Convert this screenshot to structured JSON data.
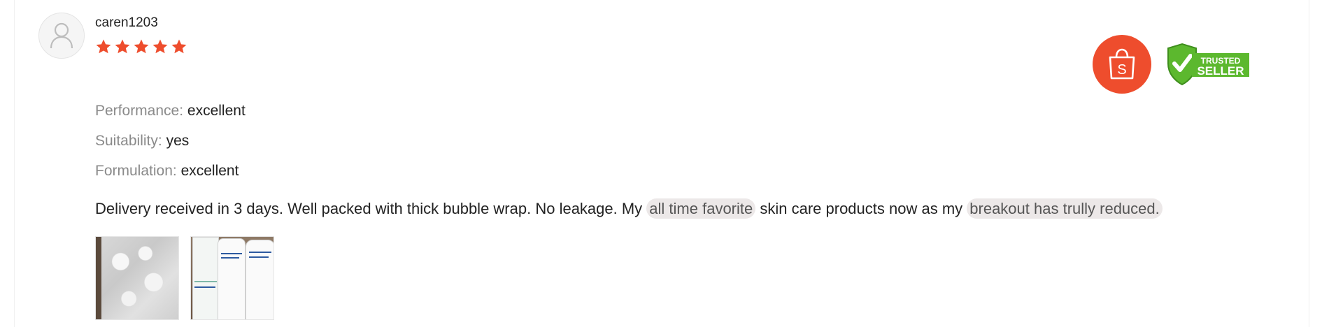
{
  "review": {
    "username": "caren1203",
    "rating": 5,
    "rating_color": "#ee4d2d",
    "attributes": [
      {
        "key": "Performance:",
        "value": "excellent"
      },
      {
        "key": "Suitability:",
        "value": "yes"
      },
      {
        "key": "Formulation:",
        "value": "excellent"
      }
    ],
    "comment": {
      "part1": "Delivery received in 3 days. Well packed with thick bubble wrap. No leakage. My ",
      "highlight1": "all time favorite",
      "part2": " skin care products now as my ",
      "highlight2": "breakout has trully reduced."
    },
    "photos": [
      {
        "icon": "bubble-wrap-photo"
      },
      {
        "icon": "skincare-bottles-photo"
      }
    ]
  },
  "badges": {
    "shop_icon": "shopee-bag-icon",
    "shop_letter": "S",
    "shop_color": "#ee4d2d",
    "trusted_line1": "TRUSTED",
    "trusted_line2": "SELLER",
    "trusted_color": "#5cb82e"
  }
}
